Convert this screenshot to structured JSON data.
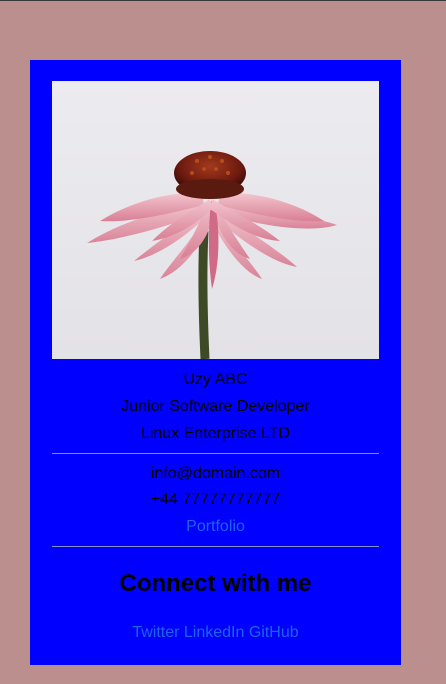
{
  "profile": {
    "name": "Uzy ABC",
    "title": "Junior Software Developer",
    "company": "Linux Enterprise LTD"
  },
  "contact": {
    "email": "info@domain.com",
    "phone": "+44 77777777777",
    "portfolio_label": "Portfolio"
  },
  "connect": {
    "heading": "Connect with me",
    "links": [
      "Twitter",
      "LinkedIn",
      "GitHub"
    ]
  },
  "colors": {
    "page_background": "#bc8f8f",
    "card_background": "#0000ff",
    "link": "#1e64e6"
  },
  "image": {
    "icon": "coneflower-photo"
  }
}
